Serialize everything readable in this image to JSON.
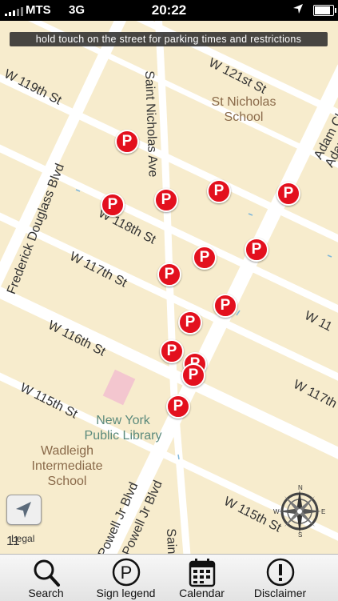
{
  "status_bar": {
    "carrier": "MTS",
    "network": "3G",
    "time": "20:22"
  },
  "map": {
    "banner": "hold touch on the street for parking times and restrictions",
    "streets": [
      "W 121st St",
      "W 119th St",
      "Saint Nicholas Ave",
      "Frederick Douglass Blvd",
      "W 118th St",
      "W 117th St",
      "W 116th St",
      "W 115th St",
      "Adam Cl",
      "Adam",
      "W 11",
      "W 117th S",
      "W 115th St",
      "Powell Jr Blvd",
      "n Powell Jr Blvd",
      "Sain",
      "11"
    ],
    "pois": {
      "school1": "St Nicholas\nSchool",
      "library": "New York\nPublic Library",
      "school2": "Wadleigh\nIntermediate\nSchool"
    },
    "pin_label": "P",
    "legal": "Legal",
    "compass_letters": [
      "N",
      "E",
      "S",
      "W"
    ]
  },
  "tabbar": {
    "tabs": [
      {
        "label": "Search",
        "icon": "search-icon"
      },
      {
        "label": "Sign legend",
        "icon": "parking-sign-icon"
      },
      {
        "label": "Calendar",
        "icon": "calendar-icon"
      },
      {
        "label": "Disclaimer",
        "icon": "info-exclamation-icon"
      }
    ]
  }
}
